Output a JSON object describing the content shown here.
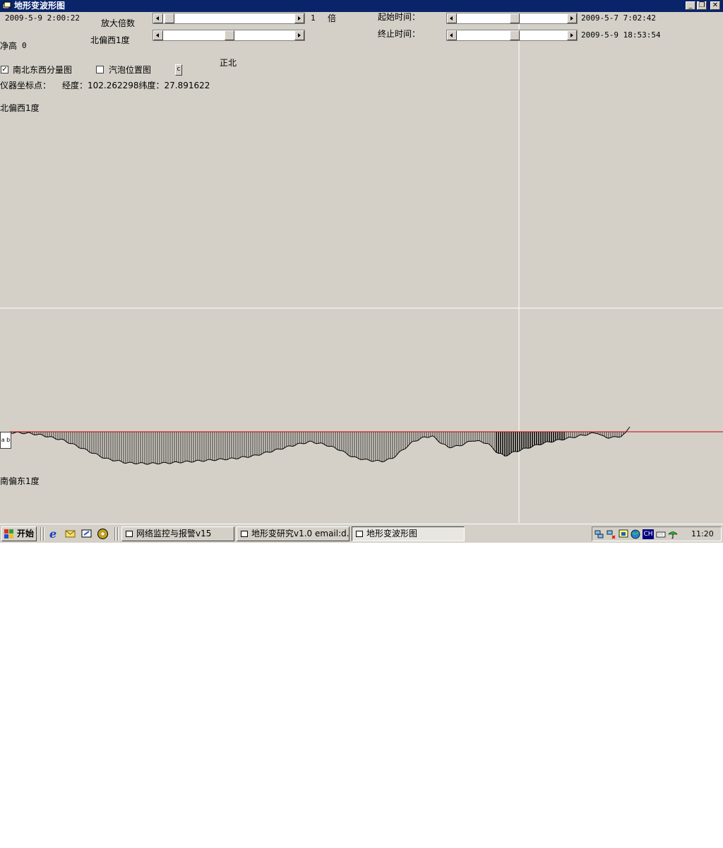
{
  "window": {
    "title": "地形变波形图"
  },
  "controls": {
    "current_time": "2009-5-9 2:00:22",
    "zoom_label": "放大倍数",
    "zoom_value": "1",
    "zoom_unit": "倍",
    "direction_label": "北偏西1度",
    "net_height_label": "净高",
    "net_height_value": "0",
    "start_time_label": "起始时间：",
    "start_time_value": "2009-5-7 7:02:42",
    "end_time_label": "终止时间：",
    "end_time_value": "2009-5-9 18:53:54",
    "checkbox_component": {
      "label": "南北东西分量图",
      "checked": true,
      "mark": "✓"
    },
    "checkbox_bubble": {
      "label": "汽泡位置图",
      "checked": false
    },
    "small_button": "c",
    "instrument_label": "仪器坐标点：",
    "coords": "经度：102.262298纬度：27.891622"
  },
  "plot": {
    "north_label": "正北",
    "top_label": "北偏西1度",
    "bottom_label": "南偏东1度",
    "series_tab": "a b",
    "colors": {
      "baseline": "#cc0000",
      "axes": "#ffffff",
      "bars": "#000000"
    }
  },
  "taskbar": {
    "start_label": "开始",
    "tasks": [
      {
        "label": "网络监控与报警v15",
        "active": false
      },
      {
        "label": "地形变研究v1.0 email:d...",
        "active": false
      },
      {
        "label": "地形变波形图",
        "active": true
      }
    ],
    "tray_time": "11:20",
    "tray_ch": "CH"
  },
  "icons": [
    "window-app-icon",
    "minimize-icon",
    "restore-icon",
    "close-icon",
    "ie-icon",
    "outlook-icon",
    "desktop-icon",
    "media-icon",
    "network-icon",
    "volume-icon",
    "globe-icon",
    "keyboard-icon",
    "umbrella-icon"
  ]
}
